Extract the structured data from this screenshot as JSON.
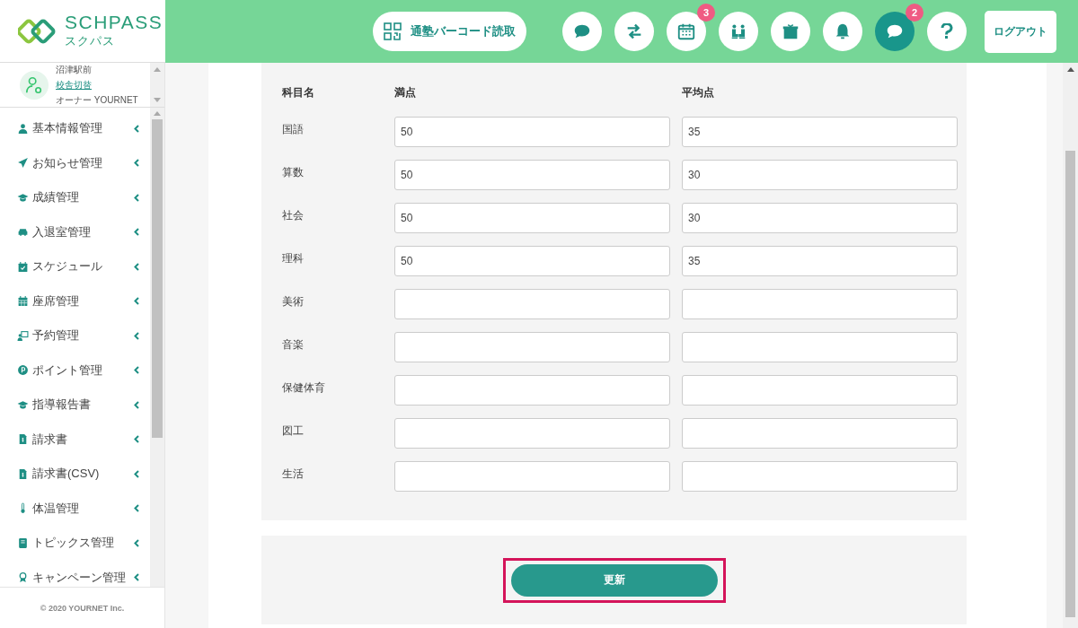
{
  "logo": {
    "name": "SCHPASS",
    "subtitle": "スクパス"
  },
  "header": {
    "barcode_button": "通塾バーコード読取",
    "icon_buttons": [
      {
        "selected": false
      },
      {
        "selected": false
      },
      {
        "selected": false,
        "badge": "3"
      },
      {
        "selected": false
      },
      {
        "selected": false
      },
      {
        "selected": false
      },
      {
        "selected": true,
        "badge": "2"
      },
      {
        "selected": false
      }
    ],
    "logout_button": "ログアウト"
  },
  "profile": {
    "school": "沼津駅前",
    "switch_link": "校舎切替",
    "owner": "オーナー YOURNET"
  },
  "sidebar": {
    "items": [
      {
        "label": "基本情報管理"
      },
      {
        "label": "お知らせ管理"
      },
      {
        "label": "成績管理"
      },
      {
        "label": "入退室管理"
      },
      {
        "label": "スケジュール"
      },
      {
        "label": "座席管理"
      },
      {
        "label": "予約管理"
      },
      {
        "label": "ポイント管理"
      },
      {
        "label": "指導報告書"
      },
      {
        "label": "請求書"
      },
      {
        "label": "請求書(CSV)"
      },
      {
        "label": "体温管理"
      },
      {
        "label": "トピックス管理"
      },
      {
        "label": "キャンペーン管理"
      }
    ],
    "footer": "© 2020 YOURNET Inc."
  },
  "form": {
    "columns": [
      "科目名",
      "満点",
      "平均点"
    ],
    "rows": [
      {
        "subject": "国語",
        "full": "50",
        "average": "35"
      },
      {
        "subject": "算数",
        "full": "50",
        "average": "30"
      },
      {
        "subject": "社会",
        "full": "50",
        "average": "30"
      },
      {
        "subject": "理科",
        "full": "50",
        "average": "35"
      },
      {
        "subject": "美術"
      },
      {
        "subject": "音楽"
      },
      {
        "subject": "保健体育"
      },
      {
        "subject": "図工"
      },
      {
        "subject": "生活"
      }
    ],
    "update_button": {
      "label": "更新",
      "highlighted": true
    }
  }
}
